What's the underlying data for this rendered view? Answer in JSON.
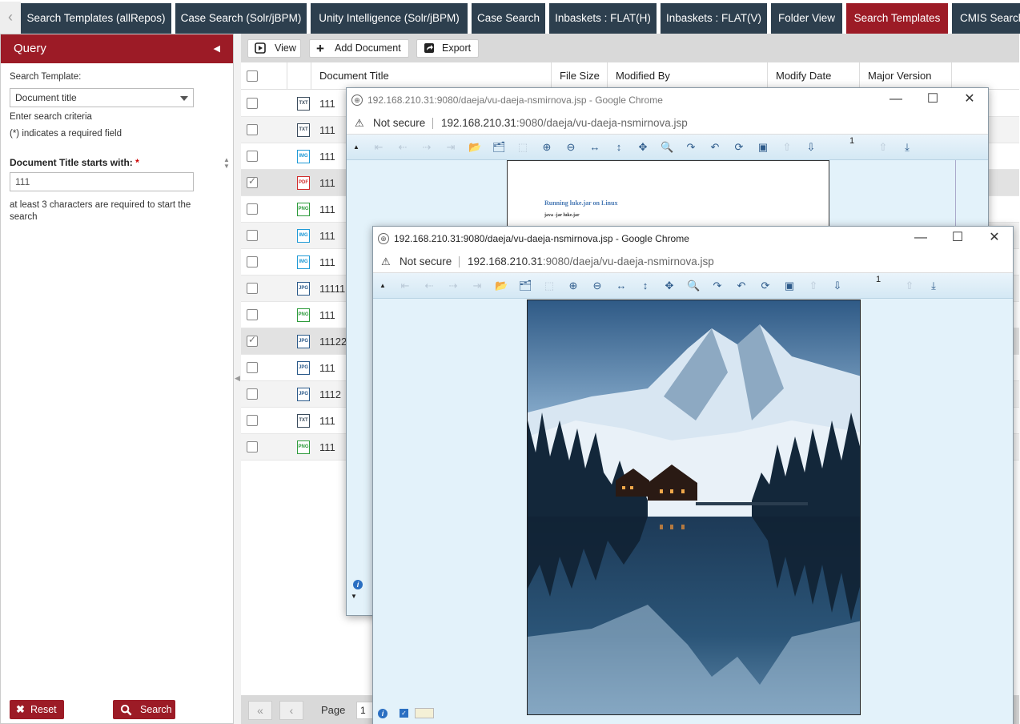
{
  "tabs": [
    {
      "label": "Search Templates (allRepos)",
      "active": false
    },
    {
      "label": "Case Search (Solr/jBPM)",
      "active": false
    },
    {
      "label": "Unity Intelligence (Solr/jBPM)",
      "active": false
    },
    {
      "label": "Case Search",
      "active": false
    },
    {
      "label": "Inbaskets : FLAT(H)",
      "active": false
    },
    {
      "label": "Inbaskets : FLAT(V)",
      "active": false
    },
    {
      "label": "Folder View",
      "active": false
    },
    {
      "label": "Search Templates",
      "active": true
    },
    {
      "label": "CMIS Search",
      "active": false
    }
  ],
  "query": {
    "title": "Query",
    "search_template_label": "Search Template:",
    "search_template_value": "Document title",
    "enter_criteria": "Enter search criteria",
    "required_note": "(*) indicates a required field",
    "field_label": "Document Title starts with:",
    "required_mark": "*",
    "field_value": "111",
    "hint": "at least 3 characters are required to start the search",
    "reset_label": "Reset",
    "search_label": "Search"
  },
  "toolbar": {
    "view_label": "View",
    "add_document_label": "Add Document",
    "export_label": "Export"
  },
  "grid": {
    "columns": [
      "Document Title",
      "File Size",
      "Modified By",
      "Modify Date",
      "Major Version"
    ],
    "rows": [
      {
        "type": "TXT",
        "title": "111",
        "checked": false
      },
      {
        "type": "TXT",
        "title": "111",
        "checked": false
      },
      {
        "type": "IMG",
        "title": "111",
        "checked": false
      },
      {
        "type": "PDF",
        "title": "111",
        "checked": true
      },
      {
        "type": "PNG",
        "title": "111",
        "checked": false
      },
      {
        "type": "IMG",
        "title": "111",
        "checked": false
      },
      {
        "type": "IMG",
        "title": "111",
        "checked": false
      },
      {
        "type": "JPG",
        "title": "11111",
        "checked": false
      },
      {
        "type": "PNG",
        "title": "111",
        "checked": false
      },
      {
        "type": "JPG",
        "title": "11122",
        "checked": true
      },
      {
        "type": "JPG",
        "title": "111",
        "checked": false
      },
      {
        "type": "JPG",
        "title": "1112",
        "checked": false
      },
      {
        "type": "TXT",
        "title": "111",
        "checked": false
      },
      {
        "type": "PNG",
        "title": "111",
        "checked": false
      }
    ]
  },
  "pager": {
    "page_label": "Page",
    "page_value": "1"
  },
  "colors": {
    "brand_red": "#9c1b26",
    "tab_dark": "#2d3f4e",
    "viewer_bg": "#e3f2fa"
  },
  "window_back": {
    "title": "192.168.210.31:9080/daeja/vu-daeja-nsmirnova.jsp - Google Chrome",
    "not_secure": "Not secure",
    "url_host": "192.168.210.31",
    "url_rest": ":9080/daeja/vu-daeja-nsmirnova.jsp",
    "page_number": "1",
    "doc_heading": "Running luke.jar on Linux",
    "doc_line": "java -jar luke.jar"
  },
  "window_front": {
    "title": "192.168.210.31:9080/daeja/vu-daeja-nsmirnova.jsp - Google Chrome",
    "not_secure": "Not secure",
    "url_host": "192.168.210.31",
    "url_rest": ":9080/daeja/vu-daeja-nsmirnova.jsp",
    "page_number": "1",
    "image_alt": "snowy mountain lake with lodge at dusk"
  }
}
